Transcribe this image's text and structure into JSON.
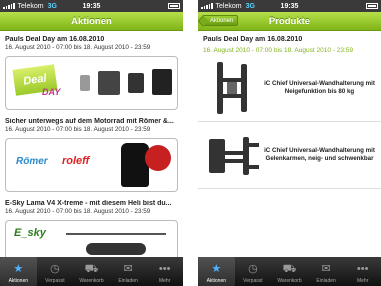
{
  "status": {
    "carrier": "Telekom",
    "network": "3G",
    "time": "19:35"
  },
  "left": {
    "nav_title": "Aktionen",
    "deals": [
      {
        "title": "Pauls Deal Day am 16.08.2010",
        "dates": "16. August 2010 - 07:00 bis 18. August 2010 - 23:59",
        "banner_text": [
          "Deal",
          "DAY"
        ]
      },
      {
        "title": "Sicher unterwegs auf dem Motorrad mit Römer &...",
        "dates": "16. August 2010 - 07:00 bis 18. August 2010 - 23:59",
        "banner_text": [
          "Römer",
          "roleff"
        ]
      },
      {
        "title": "E-Sky Lama V4 X-treme - mit diesem Heli bist du...",
        "dates": "16. August 2010 - 07:00 bis 18. August 2010 - 23:59",
        "banner_text": [
          "E_sky"
        ]
      }
    ]
  },
  "right": {
    "nav_title": "Produkte",
    "back_label": "Aktionen",
    "deal_title": "Pauls Deal Day am 16.08.2010",
    "deal_dates": "16. August 2010 - 07:00 bis 18. August 2010 - 23:59",
    "products": [
      {
        "name": "iC Chief Universal-Wandhalterung mit Neigefunktion bis 80 kg"
      },
      {
        "name": "iC Chief Universal-Wandhalterung mit Gelenkarmen, neig- und schwenkbar"
      }
    ]
  },
  "tabs": [
    {
      "label": "Aktionen",
      "icon": "star-icon"
    },
    {
      "label": "Verpasst",
      "icon": "clock-icon"
    },
    {
      "label": "Warenkorb",
      "icon": "cart-icon"
    },
    {
      "label": "Einladen",
      "icon": "envelope-icon"
    },
    {
      "label": "Mehr",
      "icon": "more-icon"
    }
  ],
  "colors": {
    "accent": "#8ec21f",
    "tab_active": "#4fb2ff",
    "link_green": "#7fb418"
  }
}
